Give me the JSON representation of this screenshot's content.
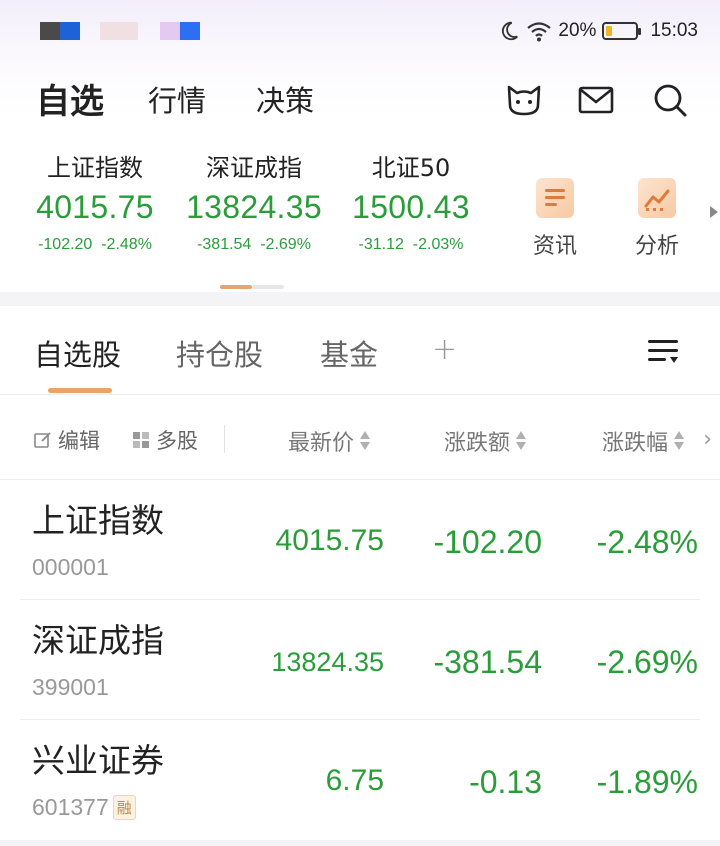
{
  "status_bar": {
    "battery": "20%",
    "time": "15:03",
    "battery_level": 0.2,
    "notification_colors": [
      "#4a4a4a",
      "#1f62d6",
      "#f0e0e4",
      "#e4c9f3",
      "#2e6ef2"
    ]
  },
  "nav": {
    "tabs": [
      {
        "label": "自选",
        "active": true
      },
      {
        "label": "行情",
        "active": false
      },
      {
        "label": "决策",
        "active": false
      }
    ],
    "icons": [
      "cat-icon",
      "mail-icon",
      "search-icon"
    ]
  },
  "indices": [
    {
      "name": "上证指数",
      "price": "4015.75",
      "change": "-102.20",
      "pct": "-2.48%"
    },
    {
      "name": "深证成指",
      "price": "13824.35",
      "change": "-381.54",
      "pct": "-2.69%"
    },
    {
      "name": "北证50",
      "price": "1500.43",
      "change": "-31.12",
      "pct": "-2.03%"
    }
  ],
  "shortcuts": [
    {
      "label": "资讯",
      "icon": "news-icon"
    },
    {
      "label": "分析",
      "icon": "analysis-icon"
    }
  ],
  "list_tabs": [
    {
      "label": "自选股",
      "active": true
    },
    {
      "label": "持仓股",
      "active": false
    },
    {
      "label": "基金",
      "active": false
    }
  ],
  "add_tab": "+",
  "header": {
    "edit": "编辑",
    "multi": "多股",
    "columns": [
      "最新价",
      "涨跌额",
      "涨跌幅"
    ]
  },
  "rows": [
    {
      "name": "上证指数",
      "code": "000001",
      "badge": "",
      "price": "4015.75",
      "change": "-102.20",
      "pct": "-2.48%"
    },
    {
      "name": "深证成指",
      "code": "399001",
      "badge": "",
      "price": "13824.35",
      "change": "-381.54",
      "pct": "-2.69%"
    },
    {
      "name": "兴业证券",
      "code": "601377",
      "badge": "融",
      "price": "6.75",
      "change": "-0.13",
      "pct": "-1.89%"
    }
  ],
  "colors": {
    "down": "#2a9d3a",
    "accent": "#e8a46a"
  }
}
